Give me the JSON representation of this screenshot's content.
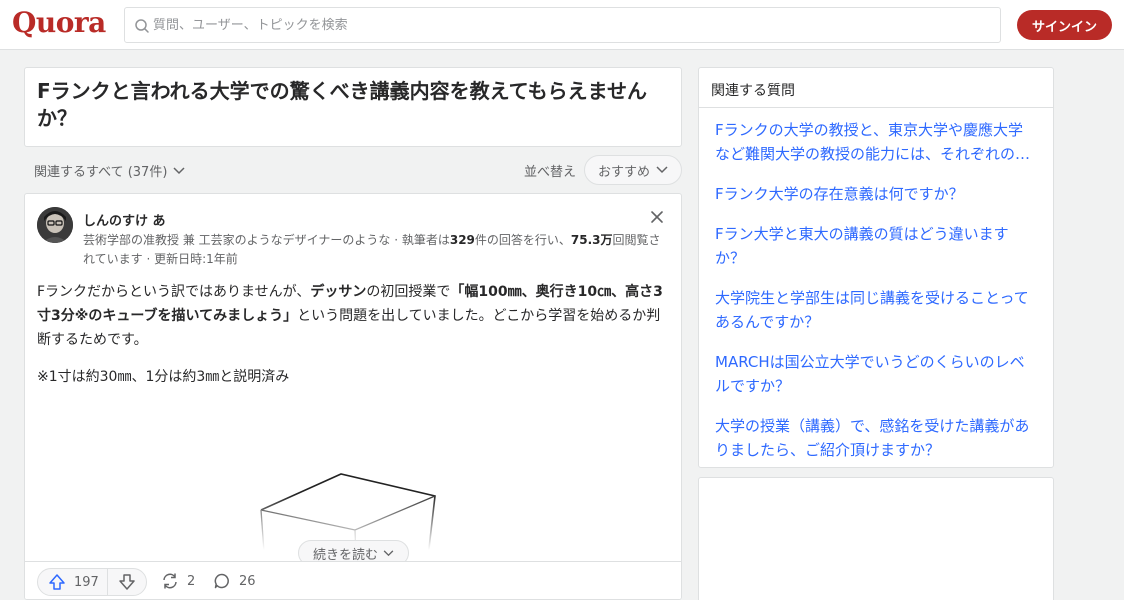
{
  "header": {
    "logo": "Quora",
    "search_placeholder": "質問、ユーザー、トピックを検索",
    "signin_label": "サインイン"
  },
  "question": {
    "title": "Fランクと言われる大学での驚くべき講義内容を教えてもらえませんか？"
  },
  "filters": {
    "related_all_label": "関連するすべて (37件)",
    "sort_label": "並べ替え",
    "sort_value": "おすすめ"
  },
  "answer": {
    "author_name": "しんのすけ あ",
    "cred_prefix": "芸術学部の准教授 兼 工芸家のようなデザイナーのような · 執筆者は",
    "answer_count": "329",
    "cred_mid": "件の回答を行い、",
    "view_count": "75.3万",
    "cred_suffix": "回閲覧されています · 更新日時:1年前",
    "body_1": "Fランクだからという訳ではありませんが、",
    "body_2": "デッサン",
    "body_3": "の初回授業で",
    "body_4": "「幅100㎜、奥行き10㎝、高さ3寸3分※のキューブを描いてみましょう」",
    "body_5": "という問題を出していました。どこから学習を始めるか判断するためです。",
    "note": "※1寸は約30㎜、1分は約3㎜と説明済み",
    "read_more_label": "続きを読む",
    "upvotes": "197",
    "shares": "2",
    "comments": "26"
  },
  "related": {
    "title": "関連する質問",
    "items": [
      "Fランクの大学の教授と、東京大学や慶應大学など難関大学の教授の能力には、それぞれの…",
      "Fランク大学の存在意義は何ですか？",
      "Fラン大学と東大の講義の質はどう違いますか？",
      "大学院生と学部生は同じ講義を受けることってあるんですか？",
      "MARCHは国公立大学でいうどのくらいのレベルですか？",
      "大学の授業（講義）で、感銘を受けた講義がありましたら、ご紹介頂けますか？"
    ]
  },
  "colors": {
    "brand": "#b92b27",
    "link": "#2e69ff",
    "background": "#f1f2f2"
  }
}
